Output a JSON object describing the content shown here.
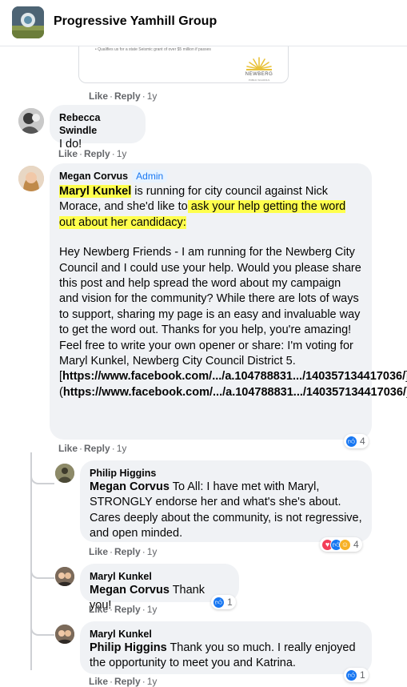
{
  "header": {
    "title": "Progressive Yamhill Group"
  },
  "preview": {
    "snippet": "• Qualifies us for a state Seismic grant of over $5 million if passes",
    "logo_name": "NEWBERG",
    "logo_sub": "PUBLIC SCHOOLS"
  },
  "actions": {
    "like": "Like",
    "reply": "Reply",
    "sep": "·",
    "time": "1y"
  },
  "comments": [
    {
      "author": "Rebecca Swindle",
      "text": "I do!"
    },
    {
      "author": "Megan Corvus",
      "badge": "Admin",
      "intro_name": "Maryl Kunkel",
      "intro_1": " is running for city council against Nick Morace, and she'd like to",
      "intro_2": " ask your help getting the word out about her candidacy:",
      "body": "Hey Newberg Friends - I am running for the Newberg City Council and I could use your help. Would you please share this post and help spread the word about my campaign and vision for the community? While there are lots of ways to support, sharing my page is an easy and invaluable way to get the word out. Thanks for you help, you're amazing! Feel free to write your own opener or share: I'm voting for Maryl Kunkel, Newberg City Council District 5.",
      "link_1_open": "[",
      "link_1": "https://www.facebook.com/.../a.104788831.../140357134417036/",
      "link_1_close": "]",
      "link_2_open": "(",
      "link_2": "https://www.facebook.com/.../a.104788831.../140357134417036/",
      "link_2_close": ")",
      "reaction_count": "4"
    }
  ],
  "replies": [
    {
      "author": "Philip Higgins",
      "mention": "Megan Corvus",
      "text": " To All: I have met with Maryl, STRONGLY endorse her and what's she's about. Cares deeply about the community, is not regressive, and open minded.",
      "reaction_count": "4"
    },
    {
      "author": "Maryl Kunkel",
      "mention": "Megan Corvus",
      "text": " Thank you!",
      "reaction_count": "1"
    },
    {
      "author": "Maryl Kunkel",
      "mention": "Philip Higgins",
      "text": " Thank you so much. I really enjoyed the opportunity to meet you and Katrina.",
      "reaction_count": "1"
    }
  ]
}
